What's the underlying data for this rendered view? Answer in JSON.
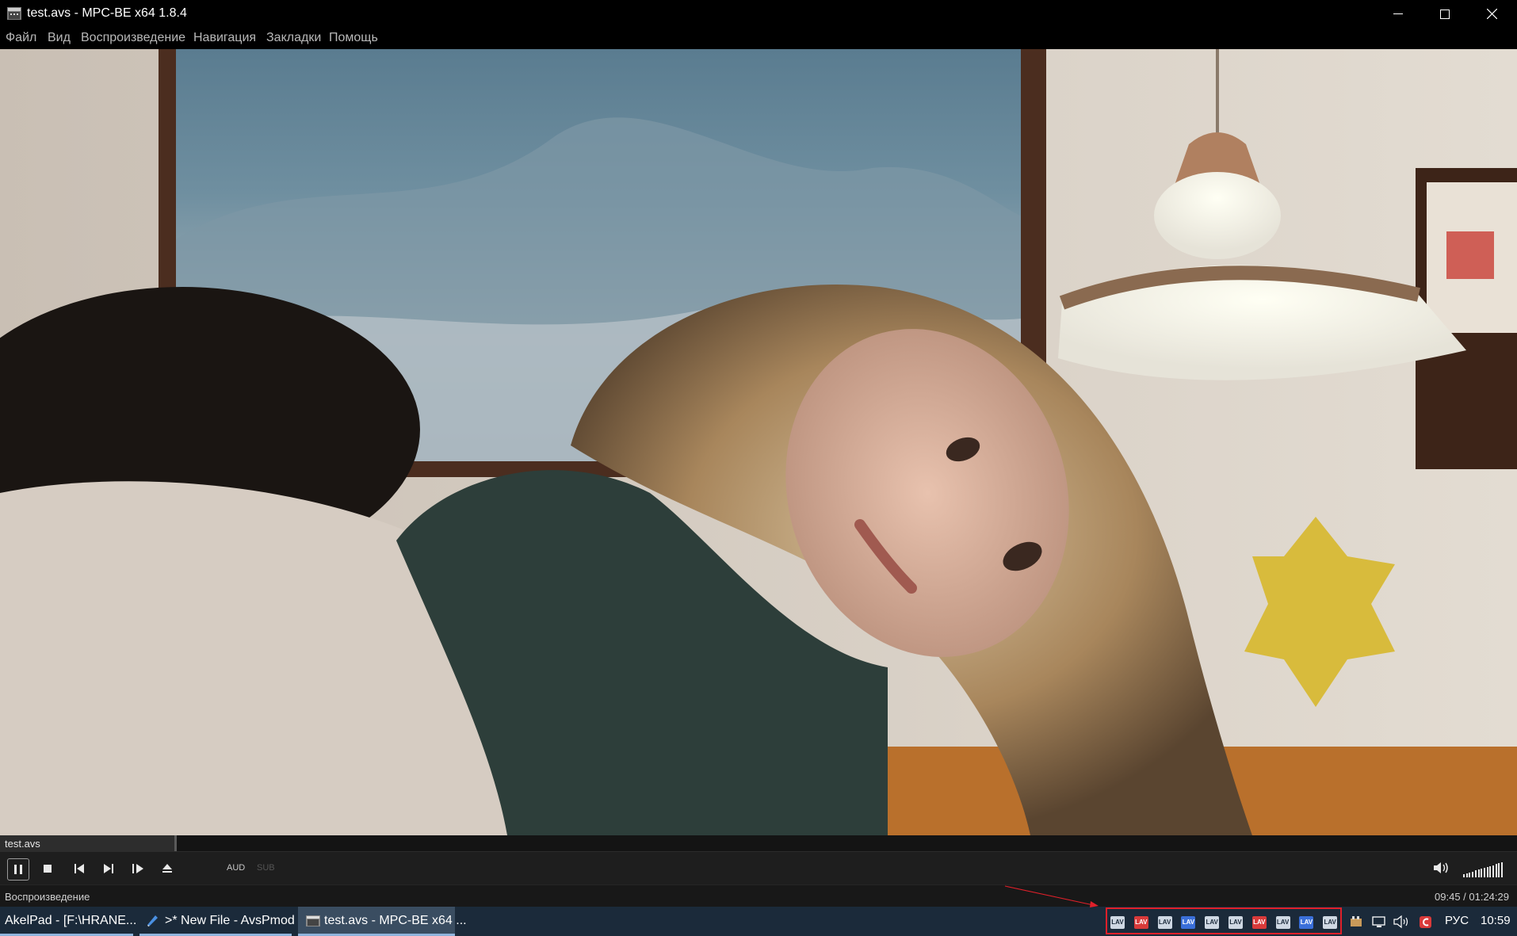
{
  "window": {
    "title": "test.avs - MPC-BE x64 1.8.4",
    "controls": [
      "minimize-icon",
      "maximize-icon",
      "close-icon"
    ]
  },
  "menu": {
    "items": [
      "Файл",
      "Вид",
      "Воспроизведение",
      "Навигация",
      "Закладки",
      "Помощь"
    ]
  },
  "seek": {
    "filename": "test.avs",
    "progress_fraction": 0.115
  },
  "controls": {
    "buttons": [
      "pause-icon",
      "stop-icon",
      "prev-icon",
      "next-icon",
      "frame-step-icon",
      "eject-icon"
    ],
    "audio_label": "AUD",
    "subtitle_label": "SUB",
    "volume_level": 1.0
  },
  "status": {
    "state": "Воспроизведение",
    "time": "09:45 / 01:24:29"
  },
  "taskbar": {
    "tasks": [
      {
        "label": "AkelPad - [F:\\HRANE..."
      },
      {
        "label": ">* New File - AvsPmod"
      },
      {
        "label": "test.avs - MPC-BE x64 ..."
      }
    ],
    "tray_icon_text": "LAV",
    "tray_icon_colors": [
      "#cfd8e3",
      "#d93a3a",
      "#cfd8e3",
      "#3a6fd9",
      "#cfd8e3",
      "#cfd8e3",
      "#d93a3a",
      "#cfd8e3",
      "#3a6fd9",
      "#cfd8e3"
    ],
    "language": "РУС",
    "clock": "10:59",
    "highlight_color": "#e0202a"
  }
}
